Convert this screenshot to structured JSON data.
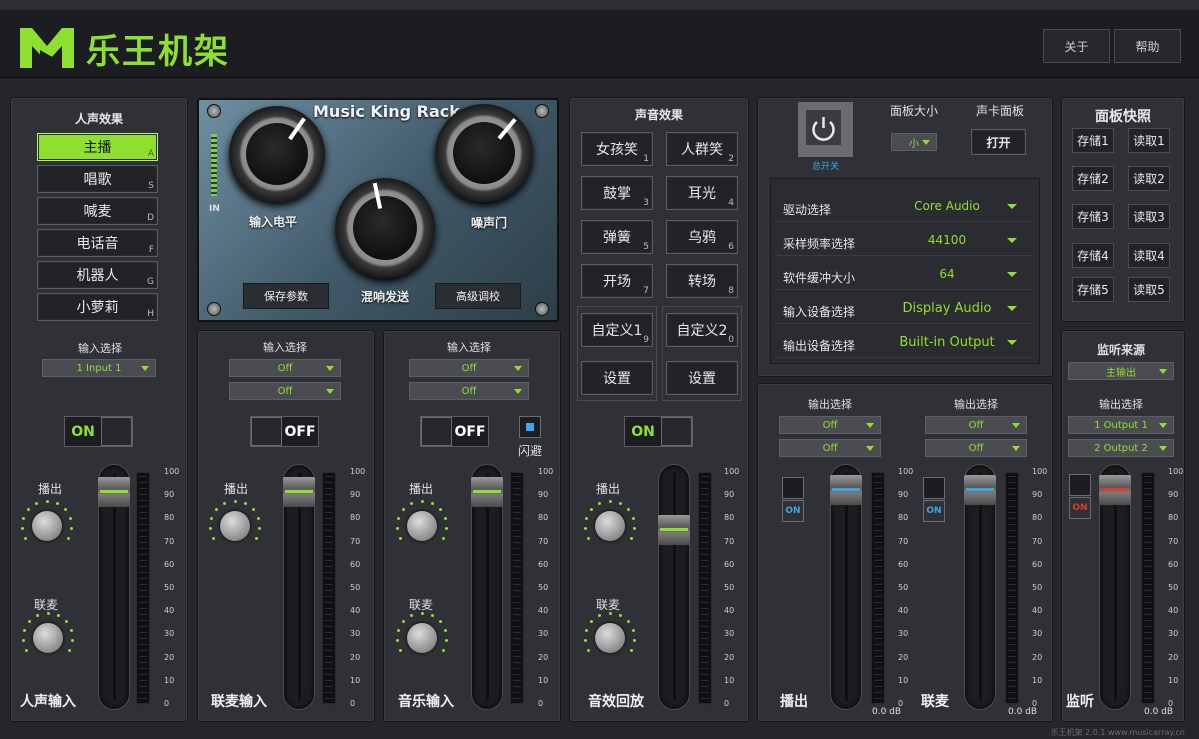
{
  "app": {
    "brand": "乐王机架",
    "about": "关于",
    "help": "帮助",
    "footer": "乐王机架 2.0.1 www.musicarray.cn"
  },
  "colors": {
    "accent": "#8fe02e",
    "blue": "#3ba7e8",
    "red": "#e03a2e",
    "bg": "#24262b"
  },
  "voice": {
    "title": "人声效果",
    "effects": [
      {
        "label": "主播",
        "key": "A"
      },
      {
        "label": "唱歌",
        "key": "S"
      },
      {
        "label": "喊麦",
        "key": "D"
      },
      {
        "label": "电话音",
        "key": "F"
      },
      {
        "label": "机器人",
        "key": "G"
      },
      {
        "label": "小萝莉",
        "key": "H"
      }
    ],
    "input_label": "输入选择",
    "input_value": "1 Input 1",
    "toggle": "ON",
    "knob1": "播出",
    "knob2": "联麦",
    "name": "人声输入"
  },
  "rack": {
    "title": "Music King Rack",
    "in_label": "IN",
    "knob_input": "输入电平",
    "knob_send": "混响发送",
    "knob_gate": "噪声门",
    "save": "保存参数",
    "advanced": "高级调校"
  },
  "mic": {
    "input_label": "输入选择",
    "in1": "Off",
    "in2": "Off",
    "toggle": "OFF",
    "knob1": "播出",
    "name": "联麦输入"
  },
  "music": {
    "input_label": "输入选择",
    "in1": "Off",
    "in2": "Off",
    "toggle": "OFF",
    "dodge": "闪避",
    "knob1": "播出",
    "knob2": "联麦",
    "name": "音乐输入"
  },
  "sfx": {
    "title": "声音效果",
    "buttons": [
      {
        "label": "女孩笑",
        "key": "1"
      },
      {
        "label": "人群笑",
        "key": "2"
      },
      {
        "label": "鼓掌",
        "key": "3"
      },
      {
        "label": "耳光",
        "key": "4"
      },
      {
        "label": "弹簧",
        "key": "5"
      },
      {
        "label": "乌鸦",
        "key": "6"
      },
      {
        "label": "开场",
        "key": "7"
      },
      {
        "label": "转场",
        "key": "8"
      }
    ],
    "custom1": "自定义1",
    "custom1_key": "9",
    "custom2": "自定义2",
    "custom2_key": "0",
    "setting": "设置",
    "toggle": "ON",
    "knob1": "播出",
    "knob2": "联麦",
    "name": "音效回放"
  },
  "settings": {
    "power": "总开关",
    "panel_size_label": "面板大小",
    "panel_size": "小",
    "soundcard_label": "声卡面板",
    "soundcard_btn": "打开",
    "rows": [
      {
        "k": "驱动选择",
        "v": "Core Audio"
      },
      {
        "k": "采样频率选择",
        "v": "44100"
      },
      {
        "k": "软件缓冲大小",
        "v": "64"
      },
      {
        "k": "输入设备选择",
        "v": "Display Audio"
      },
      {
        "k": "输出设备选择",
        "v": "Built-in Output"
      }
    ]
  },
  "out": {
    "label1": "输出选择",
    "a1": "Off",
    "a2": "Off",
    "on1": "ON",
    "db1": "0.0 dB",
    "name1": "播出",
    "label2": "输出选择",
    "b1": "Off",
    "b2": "Off",
    "on2": "ON",
    "db2": "0.0 dB",
    "name2": "联麦"
  },
  "snap": {
    "title": "面板快照",
    "store": [
      "存储1",
      "存储2",
      "存储3",
      "存储4",
      "存储5"
    ],
    "load": [
      "读取1",
      "读取2",
      "读取3",
      "读取4",
      "读取5"
    ]
  },
  "monitor": {
    "title": "监听来源",
    "source": "主输出",
    "out_label": "输出选择",
    "o1": "1 Output 1",
    "o2": "2 Output 2",
    "on": "ON",
    "db": "0.0 dB",
    "name": "监听"
  },
  "scale": [
    "100",
    "90",
    "80",
    "70",
    "60",
    "50",
    "40",
    "30",
    "20",
    "10",
    "0"
  ]
}
